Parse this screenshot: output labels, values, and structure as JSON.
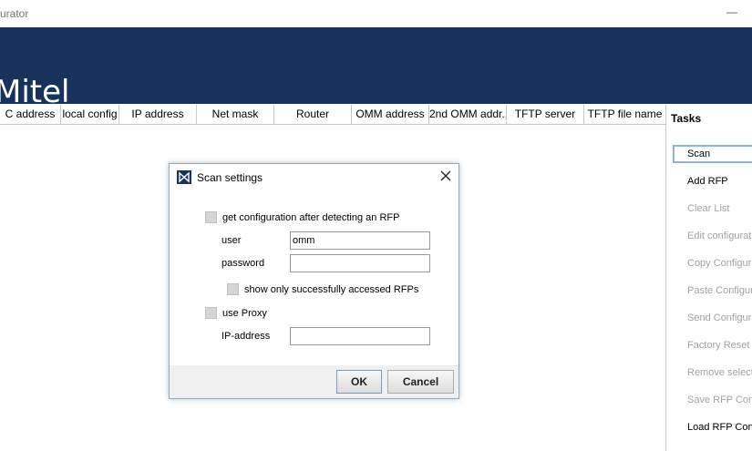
{
  "window": {
    "title": "urator",
    "minimize_glyph": "—"
  },
  "header": {
    "logo_text": "Mitel",
    "background": "#17325b"
  },
  "table": {
    "columns": [
      "C address",
      "local config",
      "IP address",
      "Net mask",
      "Router",
      "OMM address",
      "2nd OMM addr...",
      "TFTP server",
      "TFTP file name"
    ]
  },
  "tasks": {
    "title": "Tasks",
    "items": [
      {
        "label": "Scan",
        "enabled": true
      },
      {
        "label": "Add RFP",
        "enabled": true
      },
      {
        "label": "Clear List",
        "enabled": false
      },
      {
        "label": "Edit configurati",
        "enabled": false
      },
      {
        "label": "Copy Configura",
        "enabled": false
      },
      {
        "label": "Paste Configur",
        "enabled": false
      },
      {
        "label": "Send Configura",
        "enabled": false
      },
      {
        "label": "Factory Reset",
        "enabled": false
      },
      {
        "label": "Remove select",
        "enabled": false
      },
      {
        "label": "Save RFP Con",
        "enabled": false
      },
      {
        "label": "Load RFP Conf",
        "enabled": true
      }
    ]
  },
  "dialog": {
    "title": "Scan settings",
    "get_config_label": "get configuration after detecting  an RFP",
    "user_label": "user",
    "user_value": "omm",
    "password_label": "password",
    "password_value": "",
    "show_only_label": "show only successfully accessed RFPs",
    "use_proxy_label": "use Proxy",
    "ip_label": "IP-address",
    "ip_value": "",
    "ok_label": "OK",
    "cancel_label": "Cancel"
  }
}
